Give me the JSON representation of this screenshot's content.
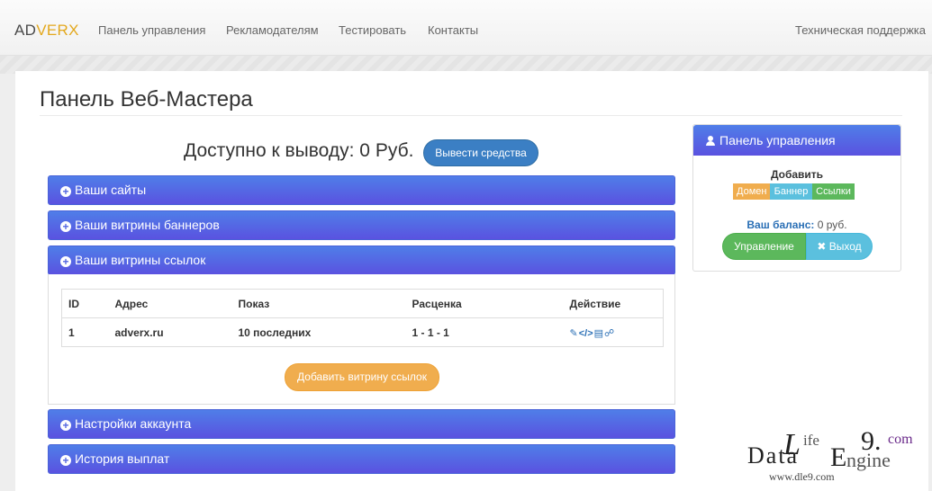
{
  "brand": {
    "part1": "AD",
    "part2": "VERX"
  },
  "nav": {
    "items": [
      "Панель управления",
      "Рекламодателям",
      "Тестировать",
      "Контакты"
    ],
    "support": "Техническая поддержка"
  },
  "page": {
    "title": "Панель Веб-Мастера",
    "available_text": "Доступно к выводу: 0 Руб.",
    "withdraw_button": "Вывести средства"
  },
  "accordion": {
    "items": [
      "Ваши сайты",
      "Ваши витрины баннеров",
      "Ваши витрины ссылок",
      "Настройки аккаунта",
      "История выплат"
    ]
  },
  "links_table": {
    "headers": [
      "ID",
      "Адрес",
      "Показ",
      "Расценка",
      "Действие"
    ],
    "rows": [
      {
        "id": "1",
        "address": "adverx.ru",
        "show": "10 последних",
        "price": "1 - 1 - 1"
      }
    ],
    "add_button": "Добавить витрину ссылок"
  },
  "side_panel": {
    "title": "Панель управления",
    "add_title": "Добавить",
    "labels": [
      "Домен",
      "Баннер",
      "Ссылки"
    ],
    "balance_label": "Ваш баланс:",
    "balance_value": "0 руб.",
    "manage_button": "Управление",
    "exit_button": "Выход"
  },
  "watermark": {
    "l": "L",
    "ife": "ife",
    "data": "Data",
    "e": "E",
    "ngine": "ngine",
    "nine": "9.",
    "com": "com",
    "url": "www.dle9.com"
  },
  "colors": {
    "accordion_top": "#4f7ee8",
    "accordion_bottom": "#5a52e0",
    "primary": "#3b7fc4",
    "warning": "#f0ad4e",
    "success": "#5cb85c",
    "info": "#5bc0de"
  }
}
